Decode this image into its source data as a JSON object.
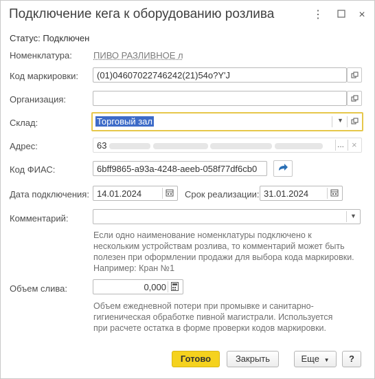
{
  "window": {
    "title": "Подключение кега к оборудованию розлива"
  },
  "status": "Статус: Подключен",
  "labels": {
    "nomenclature": "Номенклатура:",
    "marking_code": "Код маркировки:",
    "organization": "Организация:",
    "warehouse": "Склад:",
    "address": "Адрес:",
    "fias": "Код ФИАС:",
    "connect_date": "Дата подключения:",
    "sale_period": "Срок реализации:",
    "comment": "Комментарий:",
    "volume": "Объем слива:"
  },
  "values": {
    "nomenclature": "ПИВО РАЗЛИВНОЕ л",
    "marking_code": "(01)04607022746242(21)54o?Y'J",
    "organization": "",
    "warehouse": "Торговый зал",
    "address_prefix": "63",
    "fias": "6bff9865-a93a-4248-aeeb-058f77df6cb0",
    "connect_date": "14.01.2024",
    "sale_period": "31.01.2024",
    "comment": "",
    "volume": "0,000"
  },
  "help": {
    "comment": "Если одно наименование номенклатуры подключено к нескольким устройствам розлива, то комментарий может быть полезен при оформлении продажи для выбора кода маркировки. Например: Кран №1",
    "volume": "Объем ежедневной потери при промывке и санитарно-гигиеническая обработке пивной магистрали. Используется при расчете остатка в форме проверки кодов маркировки."
  },
  "buttons": {
    "ok": "Готово",
    "close": "Закрыть",
    "more": "Еще",
    "help": "?",
    "address_more": "...",
    "address_clear": "×"
  },
  "colors": {
    "accent": "#f5d21e",
    "selection": "#3d6bc8",
    "warehouse_border": "#e6c74a"
  }
}
